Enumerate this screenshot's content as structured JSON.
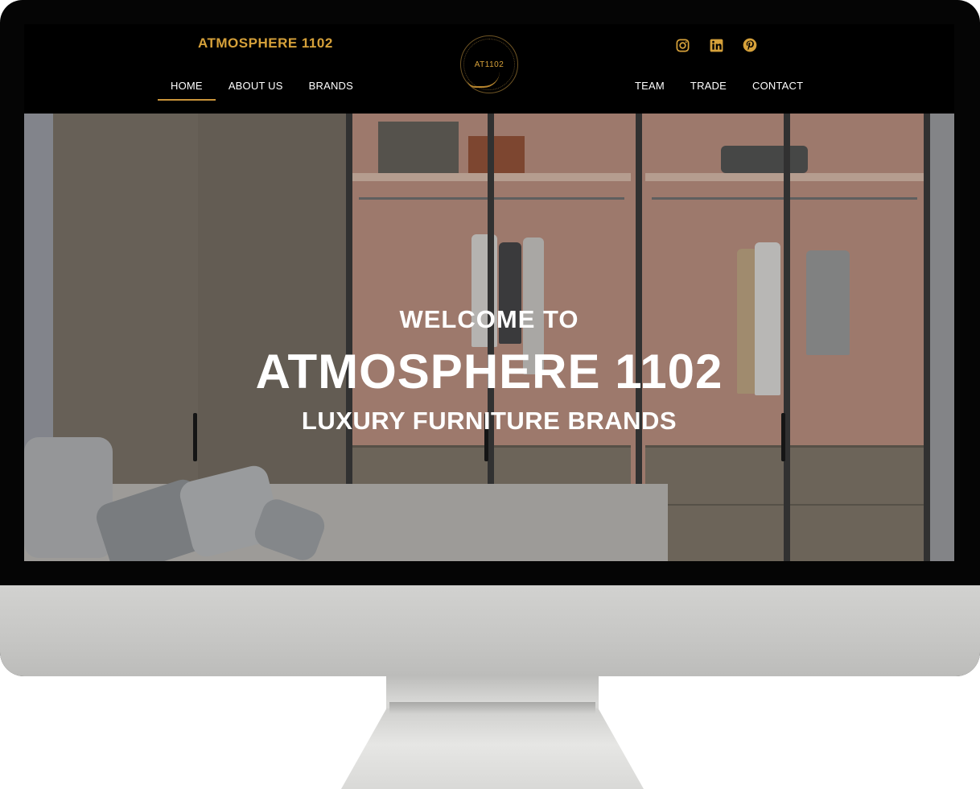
{
  "header": {
    "brand_title": "ATMOSPHERE 1102",
    "logo_text": "AT1102",
    "nav_left": [
      {
        "label": "HOME",
        "active": true
      },
      {
        "label": "ABOUT US",
        "active": false
      },
      {
        "label": "BRANDS",
        "active": false
      }
    ],
    "nav_right": [
      {
        "label": "TEAM",
        "active": false
      },
      {
        "label": "TRADE",
        "active": false
      },
      {
        "label": "CONTACT",
        "active": false
      }
    ],
    "social_icons": [
      "instagram-icon",
      "linkedin-icon",
      "pinterest-icon"
    ]
  },
  "hero": {
    "welcome": "WELCOME TO",
    "title": "ATMOSPHERE 1102",
    "subtitle": "LUXURY FURNITURE BRANDS"
  },
  "colors": {
    "accent": "#d6a13a",
    "header_bg": "#000000",
    "text_on_hero": "#ffffff"
  }
}
